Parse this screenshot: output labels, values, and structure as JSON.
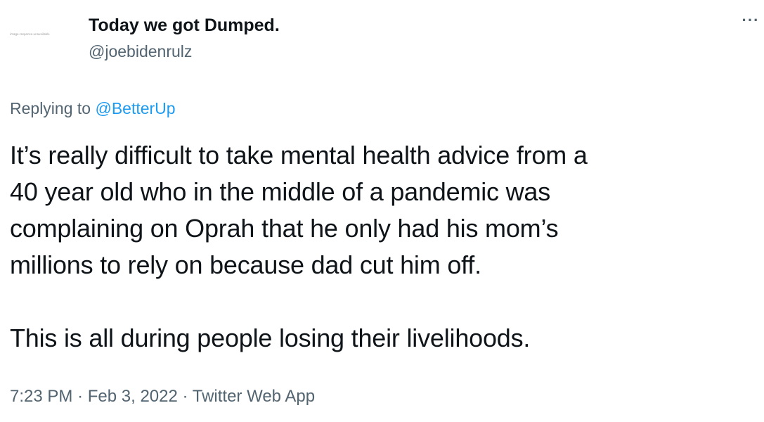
{
  "user": {
    "avatar_text": "image-response-unavailable",
    "display_name": "Today we got Dumped.",
    "handle": "@joebidenrulz"
  },
  "more_icon": "more-horizontal-icon",
  "more_label": "···",
  "reply": {
    "prefix": "Replying to",
    "mention": "@BetterUp"
  },
  "tweet": {
    "lines": [
      "It’s really difficult to take mental health advice from a",
      "40 year old who in the middle of a pandemic was",
      "complaining on Oprah that he only had his mom’s",
      "millions to rely on because dad cut him off.",
      "This is all during people losing their livelihoods."
    ]
  },
  "meta": {
    "time": "7:23 PM",
    "separator": "·",
    "date": "Feb 3, 2022",
    "source": "Twitter Web App"
  },
  "colors": {
    "text": "#0f1419",
    "secondary": "#536471",
    "link": "#1d9bf0",
    "background": "#ffffff"
  }
}
